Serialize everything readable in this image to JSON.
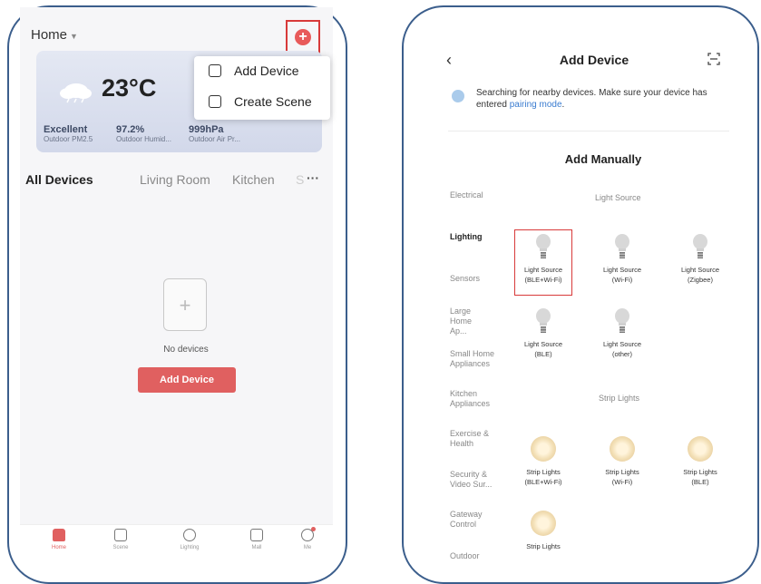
{
  "left_screen": {
    "home_title": "Home",
    "menu": {
      "add_device": "Add Device",
      "create_scene": "Create Scene"
    },
    "weather": {
      "temperature": "23°C",
      "stats": [
        {
          "value": "Excellent",
          "label": "Outdoor PM2.5"
        },
        {
          "value": "97.2%",
          "label": "Outdoor Humid..."
        },
        {
          "value": "999hPa",
          "label": "Outdoor Air Pr..."
        }
      ]
    },
    "tabs": [
      "All Devices",
      "Living Room",
      "Kitchen",
      "S"
    ],
    "empty_state": {
      "text": "No devices",
      "button": "Add Device"
    },
    "nav": [
      "Home",
      "Scene",
      "Lighting",
      "Mall",
      "Me"
    ]
  },
  "right_screen": {
    "title": "Add Device",
    "search_text": "Searching for nearby devices. Make sure your device has entered",
    "search_link": "pairing mode",
    "search_end": ".",
    "add_manually": "Add Manually",
    "categories": [
      "Electrical",
      "Lighting",
      "Sensors",
      "Large Home Ap...",
      "Small Home Appliances",
      "Kitchen Appliances",
      "Exercise & Health",
      "Security & Video Sur...",
      "Gateway Control",
      "Outdoor"
    ],
    "sections": {
      "light_source": "Light Source",
      "strip_lights": "Strip Lights"
    },
    "light_devices": [
      {
        "name": "Light Source",
        "sub": "(BLE+Wi-Fi)"
      },
      {
        "name": "Light Source",
        "sub": "(Wi-Fi)"
      },
      {
        "name": "Light Source",
        "sub": "(Zigbee)"
      },
      {
        "name": "Light Source",
        "sub": "(BLE)"
      },
      {
        "name": "Light Source",
        "sub": "(other)"
      }
    ],
    "strip_devices": [
      {
        "name": "Strip Lights",
        "sub": "(BLE+Wi-Fi)"
      },
      {
        "name": "Strip Lights",
        "sub": "(Wi-Fi)"
      },
      {
        "name": "Strip Lights",
        "sub": "(BLE)"
      },
      {
        "name": "Strip Lights",
        "sub": ""
      }
    ]
  },
  "colors": {
    "accent": "#e06060",
    "highlight": "#d83a3a",
    "frame": "#3b5e8c",
    "link": "#3a7cd0"
  }
}
